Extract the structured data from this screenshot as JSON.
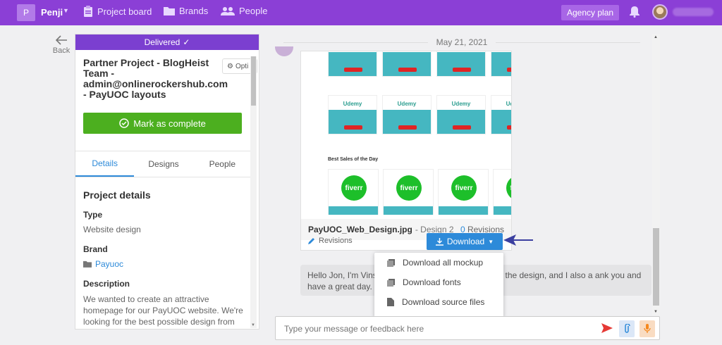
{
  "topbar": {
    "logo_letter": "P",
    "brand": "Penji",
    "nav": [
      {
        "label": "Project board",
        "icon": "clipboard-icon"
      },
      {
        "label": "Brands",
        "icon": "folder-icon"
      },
      {
        "label": "People",
        "icon": "people-icon"
      }
    ],
    "agency_plan": "Agency plan"
  },
  "back": {
    "label": "Back"
  },
  "project": {
    "status": "Delivered",
    "title": "Partner Project - BlogHeist Team - admin@onlinerockershub.com - PayUOC layouts",
    "options_label": "Opti",
    "complete_button": "Mark as complete",
    "tabs": [
      "Details",
      "Designs",
      "People"
    ],
    "details_heading": "Project details",
    "type_label": "Type",
    "type_value": "Website design",
    "brand_label": "Brand",
    "brand_value": "Payuoc",
    "description_label": "Description",
    "description_value": "We wanted to create an attractive homepage for our PayUOC website. We're looking for the best possible design from"
  },
  "chat": {
    "date": "May 21, 2021",
    "design_image": {
      "udemy_label": "Udemy",
      "sales_title": "Best Sales of the Day",
      "fiverr_label": "fiverr"
    },
    "file_name": "PayUOC_Web_Design.jpg",
    "file_design": "- Design 2",
    "revisions_count": "0",
    "revisions_word": "Revisions",
    "revisions_link": "Revisions",
    "download_button": "Download",
    "message": "Hello Jon, I'm Vins                                                  ject, here's the revised version of the design, and I also a                                                  ank you and have a great day."
  },
  "dropdown": {
    "items": [
      "Download all mockup",
      "Download fonts",
      "Download source files"
    ]
  },
  "input": {
    "placeholder": "Type your message or feedback here"
  },
  "colors": {
    "topbar": "#8b3fd6",
    "accent_blue": "#2d8ad9",
    "success_green": "#4caf1f"
  }
}
